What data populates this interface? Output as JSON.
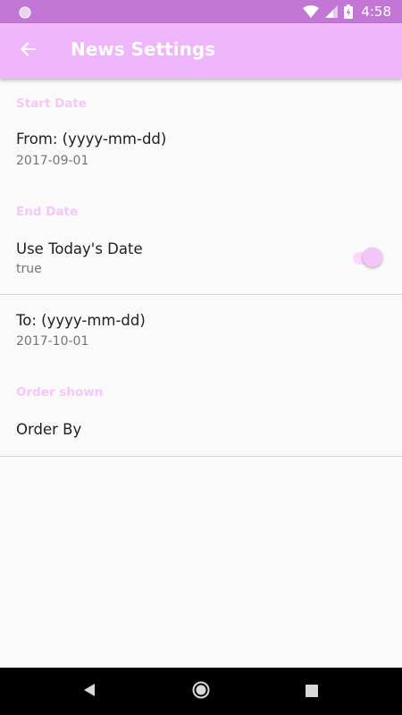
{
  "status_bar": {
    "time": "4:58",
    "icons": [
      "circle-icon",
      "wifi-icon",
      "signal-icon",
      "battery-charging-icon"
    ]
  },
  "app_bar": {
    "title": "News Settings",
    "back_icon": "arrow-back-icon"
  },
  "settings": {
    "start_date": {
      "category": "Start Date",
      "from": {
        "title": "From: (yyyy-mm-dd)",
        "summary": "2017-09-01"
      }
    },
    "end_date": {
      "category": "End Date",
      "use_today": {
        "title": "Use Today's Date",
        "summary": "true",
        "checked": true
      },
      "to": {
        "title": "To: (yyyy-mm-dd)",
        "summary": "2017-10-01"
      }
    },
    "order": {
      "category": "Order shown",
      "order_by": {
        "title": "Order By"
      }
    }
  },
  "colors": {
    "status_bar": "#c277d6",
    "app_bar": "#f0b6fb",
    "category_text": "#f6c7fb",
    "switch_thumb": "#f3c6f9",
    "switch_track": "#fbd9fd"
  },
  "nav_bar": {
    "back": "nav-back-icon",
    "home": "nav-home-icon",
    "recents": "nav-recents-icon"
  }
}
